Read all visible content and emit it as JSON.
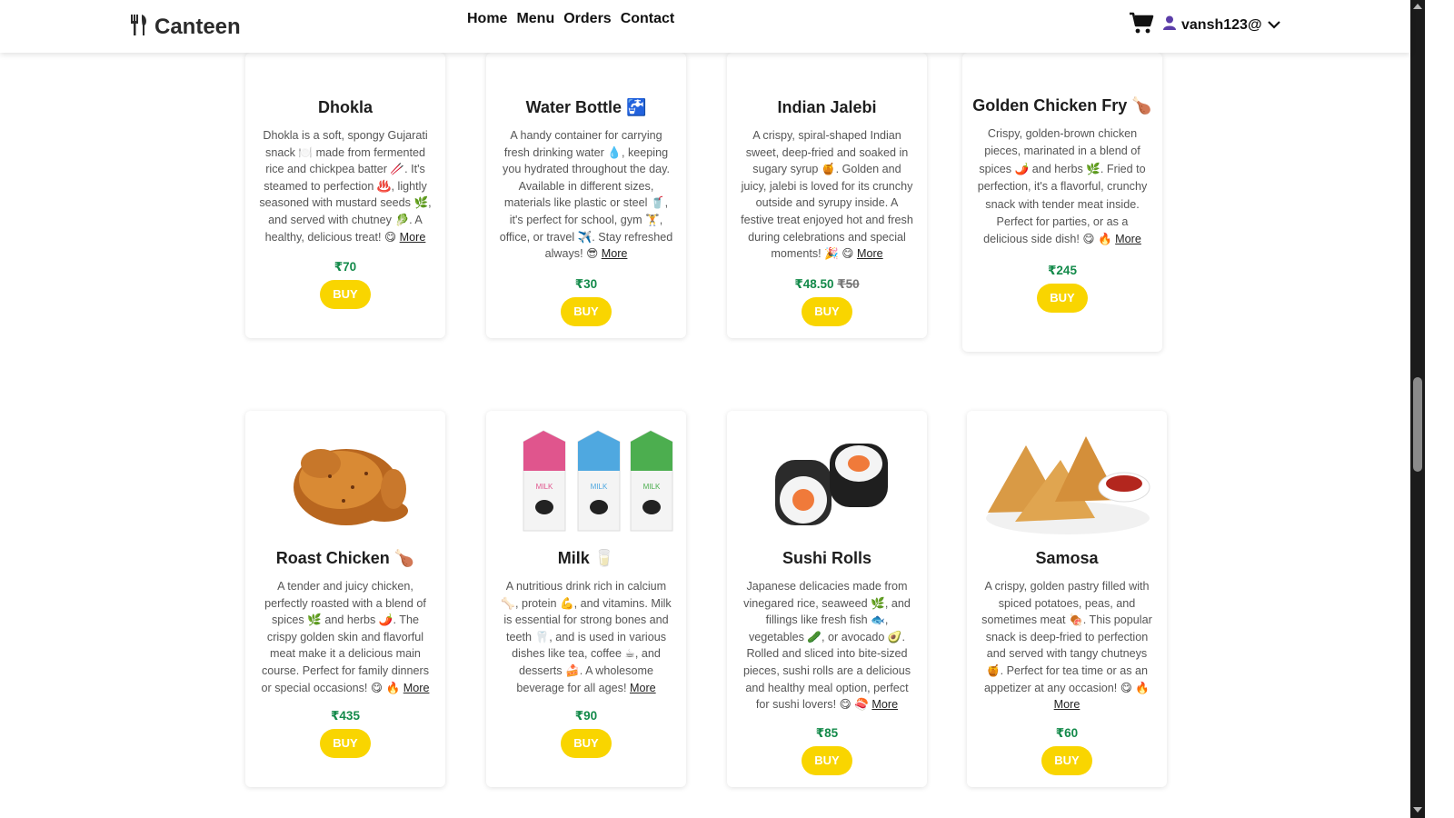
{
  "brand": {
    "name": "Canteen",
    "icon": "fork-knife-icon"
  },
  "nav": {
    "links": [
      "Home",
      "Menu",
      "Orders",
      "Contact"
    ]
  },
  "user": {
    "username": "vansh123@",
    "cart_icon": "cart-icon",
    "user_icon": "user-icon",
    "dropdown_icon": "chevron-down-icon"
  },
  "colors": {
    "accent": "#f9d500",
    "price": "#138a4a",
    "user_icon": "#5b3da8"
  },
  "products": [
    {
      "name": "Dhokla",
      "description": "Dhokla is a soft, spongy Gujarati snack 🍽️ made from fermented rice and chickpea batter 🥢. It's steamed to perfection ♨️, lightly seasoned with mustard seeds 🌿, and served with chutney 🥬. A healthy, delicious treat! 😋",
      "more": "More",
      "price": "₹70",
      "old_price": "",
      "buy": "BUY"
    },
    {
      "name": "Water Bottle 🚰",
      "description": "A handy container for carrying fresh drinking water 💧, keeping you hydrated throughout the day. Available in different sizes, materials like plastic or steel 🥤, it's perfect for school, gym 🏋️, office, or travel ✈️. Stay refreshed always! 😎",
      "more": "More",
      "price": "₹30",
      "old_price": "",
      "buy": "BUY"
    },
    {
      "name": "Indian Jalebi",
      "description": "A crispy, spiral-shaped Indian sweet, deep-fried and soaked in sugary syrup 🍯. Golden and juicy, jalebi is loved for its crunchy outside and syrupy inside. A festive treat enjoyed hot and fresh during celebrations and special moments! 🎉 😋",
      "more": "More",
      "price": "₹48.50",
      "old_price": "₹50",
      "buy": "BUY"
    },
    {
      "name": "Golden Chicken Fry 🍗",
      "description": "Crispy, golden-brown chicken pieces, marinated in a blend of spices 🌶️ and herbs 🌿. Fried to perfection, it's a flavorful, crunchy snack with tender meat inside. Perfect for parties, or as a delicious side dish! 😋 🔥",
      "more": "More",
      "price": "₹245",
      "old_price": "",
      "buy": "BUY"
    },
    {
      "name": "Roast Chicken 🍗",
      "description": "A tender and juicy chicken, perfectly roasted with a blend of spices 🌿 and herbs 🌶️. The crispy golden skin and flavorful meat make it a delicious main course. Perfect for family dinners or special occasions! 😋 🔥",
      "more": "More",
      "price": "₹435",
      "old_price": "",
      "buy": "BUY",
      "image": "roast-chicken-image"
    },
    {
      "name": "Milk 🥛",
      "description": "A nutritious drink rich in calcium 🦴, protein 💪, and vitamins. Milk is essential for strong bones and teeth 🦷, and is used in various dishes like tea, coffee ☕, and desserts 🍰. A wholesome beverage for all ages!",
      "more": "More",
      "price": "₹90",
      "old_price": "",
      "buy": "BUY",
      "image": "milk-cartons-image",
      "carton_label": "MILK"
    },
    {
      "name": "Sushi Rolls",
      "description": "Japanese delicacies made from vinegared rice, seaweed 🌿, and fillings like fresh fish 🐟, vegetables 🥒, or avocado 🥑. Rolled and sliced into bite-sized pieces, sushi rolls are a delicious and healthy meal option, perfect for sushi lovers! 😋 🍣",
      "more": "More",
      "price": "₹85",
      "old_price": "",
      "buy": "BUY",
      "image": "sushi-rolls-image"
    },
    {
      "name": "Samosa",
      "description": "A crispy, golden pastry filled with spiced potatoes, peas, and sometimes meat 🍖. This popular snack is deep-fried to perfection and served with tangy chutneys 🍯. Perfect for tea time or as an appetizer at any occasion! 😋 🔥",
      "more": "More",
      "price": "₹60",
      "old_price": "",
      "buy": "BUY",
      "image": "samosa-image"
    }
  ]
}
